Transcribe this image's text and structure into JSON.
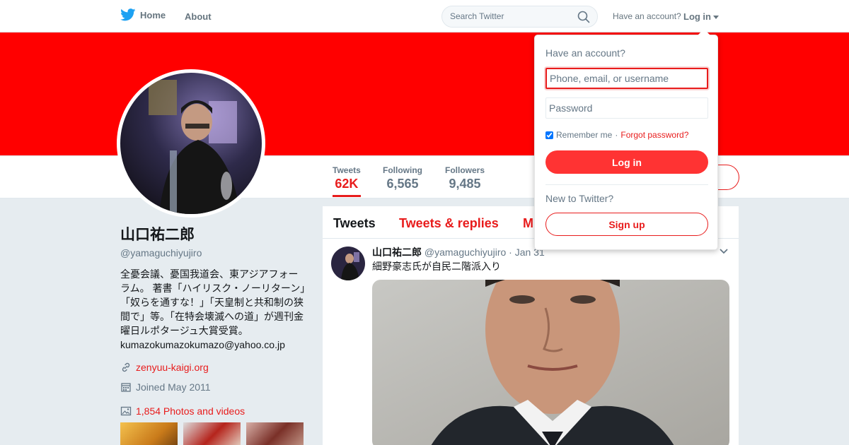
{
  "nav": {
    "home_label": "Home",
    "about_label": "About",
    "search_placeholder": "Search Twitter",
    "have_account": "Have an account?",
    "login_label": "Log in"
  },
  "colors": {
    "accent": "#e81c1c",
    "banner": "#ff0000",
    "login_button": "#ff3333"
  },
  "profile": {
    "name": "山口祐二郎",
    "handle": "@yamaguchiyujiro",
    "bio": "全憂会議、憂国我道会、東アジアフォーラム。 著書「ハイリスク・ノーリターン」「奴らを通すな！」「天皇制と共和制の狭間で」等。「在特会壊滅への道」が週刊金曜日ルポタージュ大賞受賞。 kumazokumazokumazo@yahoo.co.jp",
    "website": "zenyuu-kaigi.org",
    "joined": "Joined May 2011",
    "photos_videos": "1,854 Photos and videos"
  },
  "stats": [
    {
      "label": "Tweets",
      "value": "62K"
    },
    {
      "label": "Following",
      "value": "6,565"
    },
    {
      "label": "Followers",
      "value": "9,485"
    }
  ],
  "timeline": {
    "tabs": [
      "Tweets",
      "Tweets & replies",
      "M"
    ],
    "tweet": {
      "name": "山口祐二郎",
      "handle": "@yamaguchiyujiro",
      "date": "· Jan 31",
      "text": "細野豪志氏が自民二階派入り"
    }
  },
  "login_dropdown": {
    "title": "Have an account?",
    "username_placeholder": "Phone, email, or username",
    "password_placeholder": "Password",
    "remember_me": "Remember me",
    "separator": "·",
    "forgot_password": "Forgot password?",
    "login_button": "Log in",
    "new_to_twitter": "New to Twitter?",
    "signup_button": "Sign up"
  }
}
